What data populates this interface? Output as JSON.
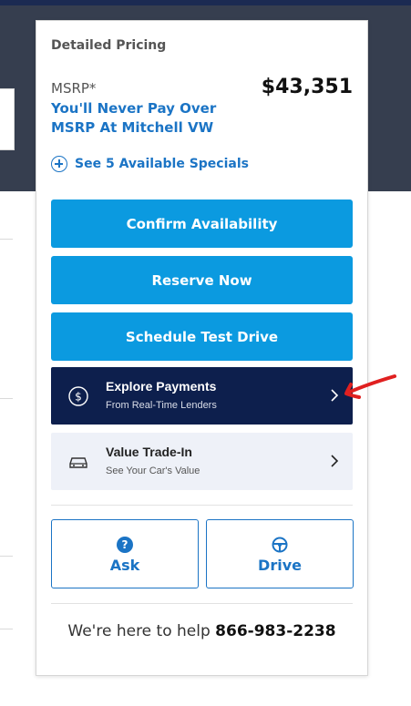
{
  "pricing": {
    "section_title": "Detailed Pricing",
    "msrp_label": "MSRP*",
    "price": "$43,351",
    "promo_line1": "You'll Never Pay Over",
    "promo_line2": "MSRP At Mitchell VW",
    "specials_link": "See 5 Available Specials"
  },
  "actions": {
    "confirm_label": "Confirm Availability",
    "reserve_label": "Reserve Now",
    "test_drive_label": "Schedule Test Drive"
  },
  "explore_payments": {
    "title": "Explore Payments",
    "subtitle": "From Real-Time Lenders",
    "icon": "dollar-circle-icon"
  },
  "value_trade": {
    "title": "Value Trade-In",
    "subtitle": "See Your Car's Value",
    "icon": "car-icon"
  },
  "quick_actions": {
    "ask_label": "Ask",
    "drive_label": "Drive"
  },
  "help": {
    "text": "We're here to help",
    "phone": "866-983-2238"
  },
  "colors": {
    "primary_blue": "#0b9ae0",
    "link_blue": "#1b74c5",
    "navy": "#0d1f4d",
    "annotation_red": "#e02020"
  }
}
